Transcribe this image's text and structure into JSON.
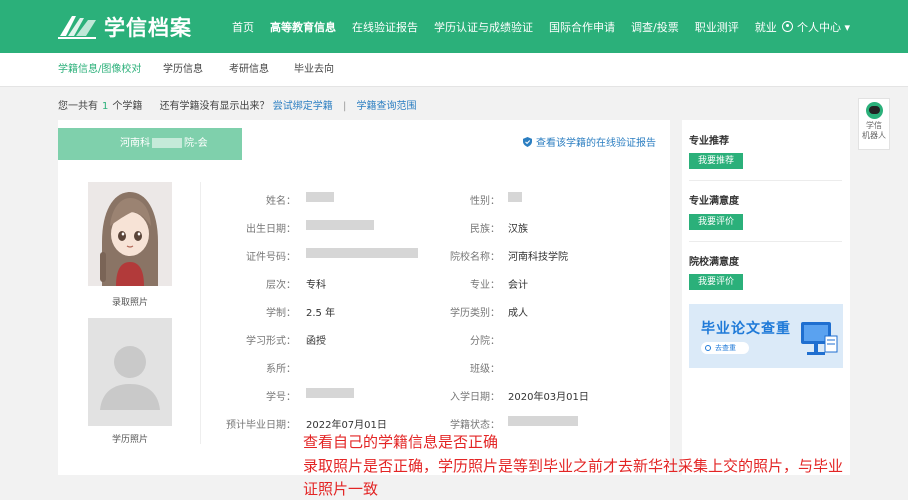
{
  "header": {
    "logo_text": "学信档案",
    "nav": [
      "首页",
      "高等教育信息",
      "在线验证报告",
      "学历认证与成绩验证",
      "国际合作申请",
      "调查/投票",
      "职业测评",
      "就业"
    ],
    "active_nav": 1,
    "user_center": "个人中心 ▾",
    "brand_color": "#2bb07a"
  },
  "subnav": {
    "items": [
      "学籍信息/图像校对",
      "学历信息",
      "考研信息",
      "毕业去向"
    ],
    "active": 0
  },
  "info_row": {
    "prefix": "您一共有",
    "count": "1",
    "suffix": "个学籍",
    "question": "还有学籍没有显示出来？",
    "bind_link": "尝试绑定学籍",
    "separator": "|",
    "range_link": "学籍查询范围"
  },
  "robot": {
    "label_1": "学信",
    "label_2": "机器人"
  },
  "card": {
    "school_left": "河南科",
    "school_right": "院-会",
    "verify_link": "查看该学籍的在线验证报告",
    "photo1_caption": "录取照片",
    "photo2_caption": "学历照片"
  },
  "fields_left": [
    {
      "label": "姓名：",
      "value": ""
    },
    {
      "label": "出生日期：",
      "value": ""
    },
    {
      "label": "证件号码：",
      "value": ""
    },
    {
      "label": "层次：",
      "value": "专科"
    },
    {
      "label": "学制：",
      "value": "2.5 年"
    },
    {
      "label": "学习形式：",
      "value": "函授"
    },
    {
      "label": "系所：",
      "value": ""
    },
    {
      "label": "学号：",
      "value": ""
    },
    {
      "label": "预计毕业日期：",
      "value": "2022年07月01日"
    }
  ],
  "fields_right": [
    {
      "label": "性别：",
      "value": ""
    },
    {
      "label": "民族：",
      "value": "汉族"
    },
    {
      "label": "院校名称：",
      "value": "河南科技学院"
    },
    {
      "label": "专业：",
      "value": "会计"
    },
    {
      "label": "学历类别：",
      "value": "成人"
    },
    {
      "label": "分院：",
      "value": ""
    },
    {
      "label": "班级：",
      "value": ""
    },
    {
      "label": "入学日期：",
      "value": "2020年03月01日"
    },
    {
      "label": "学籍状态：",
      "value": ""
    }
  ],
  "side": {
    "sections": [
      {
        "title": "专业推荐",
        "button": "我要推荐"
      },
      {
        "title": "专业满意度",
        "button": "我要评价"
      },
      {
        "title": "院校满意度",
        "button": "我要评价"
      }
    ],
    "banner_title": "毕业论文查重",
    "banner_button": "去查重"
  },
  "annotation": {
    "line1": "查看自己的学籍信息是否正确",
    "line2": "录取照片是否正确，学历照片是等到毕业之前才去新华社采集上交的照片，与毕业",
    "line3": "证照片一致",
    "color": "#e32525"
  }
}
